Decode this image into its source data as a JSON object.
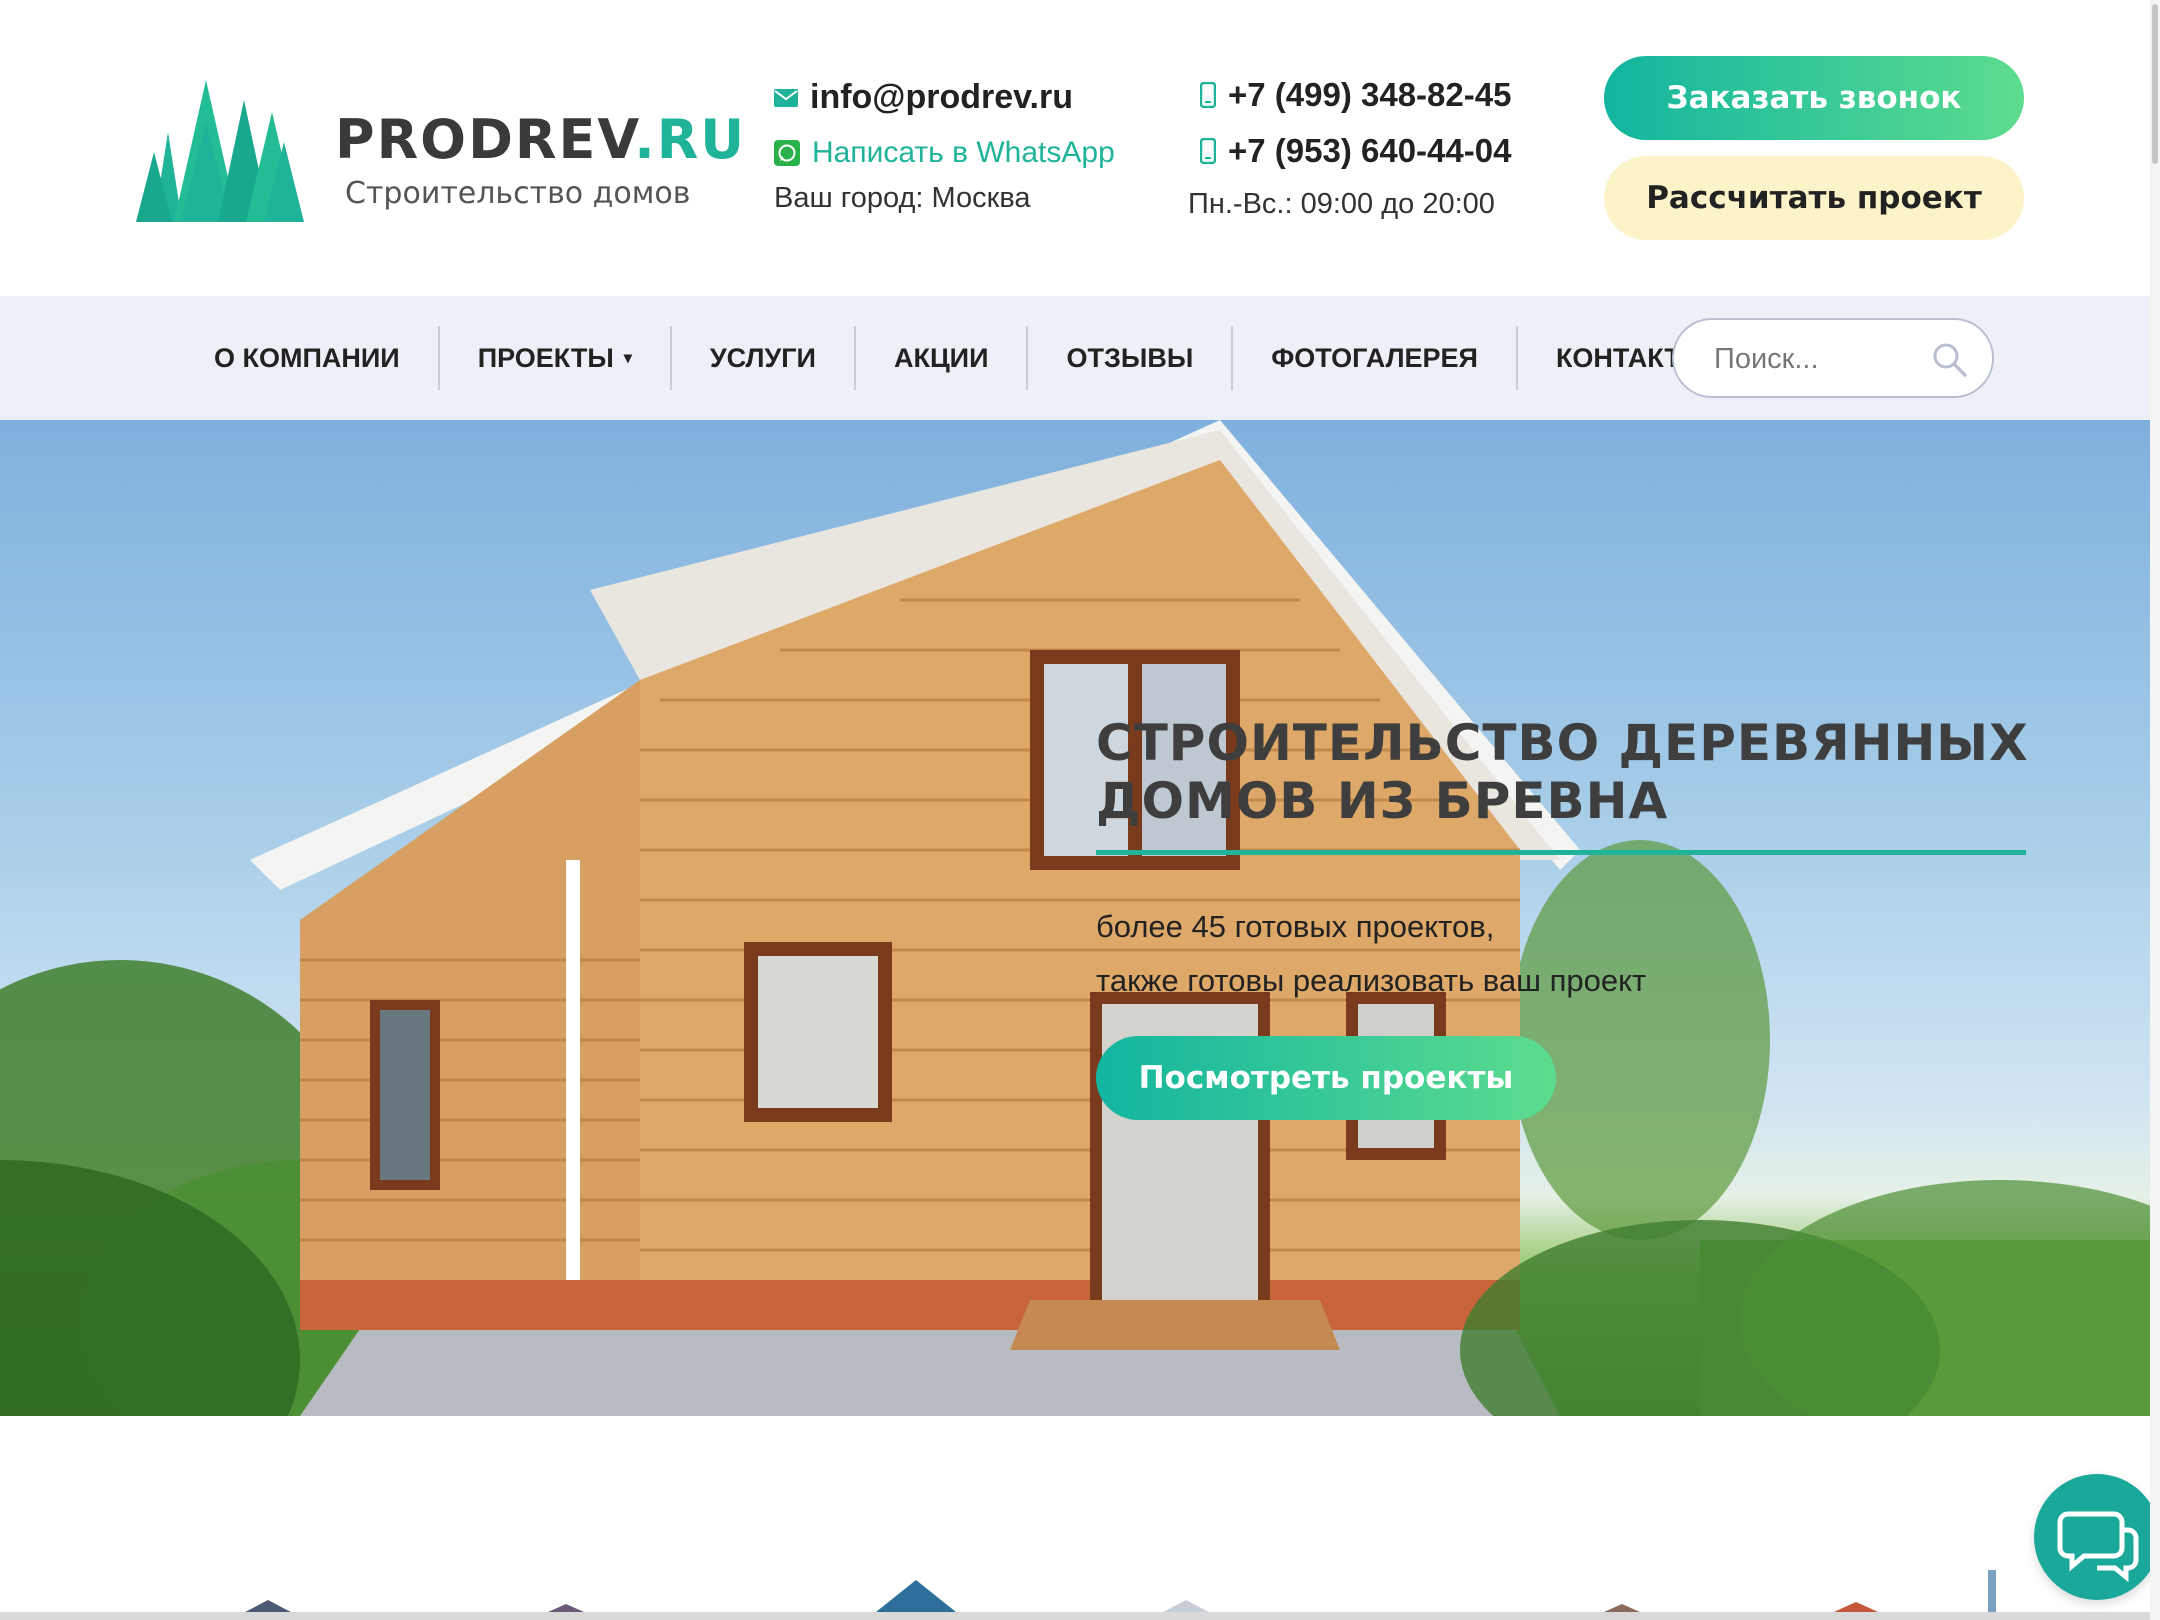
{
  "header": {
    "logo": {
      "name_main": "PRODREV",
      "name_accent": ".RU",
      "tagline": "Строительство домов"
    },
    "email": "info@prodrev.ru",
    "whatsapp_label": "Написать в WhatsApp",
    "city": "Ваш город: Москва",
    "phone_1": "+7 (499) 348-82-45",
    "phone_2": "+7 (953) 640-44-04",
    "hours": "Пн.-Вс.: 09:00 до 20:00",
    "order_call_label": "Заказать звонок",
    "calculate_label": "Рассчитать проект"
  },
  "nav": {
    "items": [
      {
        "label": "О КОМПАНИИ"
      },
      {
        "label": "ПРОЕКТЫ",
        "has_dropdown": true
      },
      {
        "label": "УСЛУГИ"
      },
      {
        "label": "АКЦИИ"
      },
      {
        "label": "ОТЗЫВЫ"
      },
      {
        "label": "ФОТОГАЛЕРЕЯ"
      },
      {
        "label": "КОНТАКТЫ"
      }
    ],
    "search_placeholder": "Поиск..."
  },
  "hero": {
    "title": "СТРОИТЕЛЬСТВО ДЕРЕВЯННЫХ ДОМОВ ИЗ БРЕВНА",
    "text_line_1": "более 45 готовых проектов,",
    "text_line_2": "также готовы реализовать ваш проект",
    "button_label": "Посмотреть проекты"
  },
  "colors": {
    "accent": "#1fb49a",
    "button_gradient_end": "#5ddc8e",
    "calc_button_bg": "#fdf3c8",
    "nav_bg": "#edf0f6",
    "chat_button": "#1aa89a"
  },
  "icons": {
    "email": "envelope-icon",
    "whatsapp": "whatsapp-icon",
    "phone": "mobile-phone-icon",
    "search": "search-icon",
    "chat": "chat-bubbles-icon"
  }
}
